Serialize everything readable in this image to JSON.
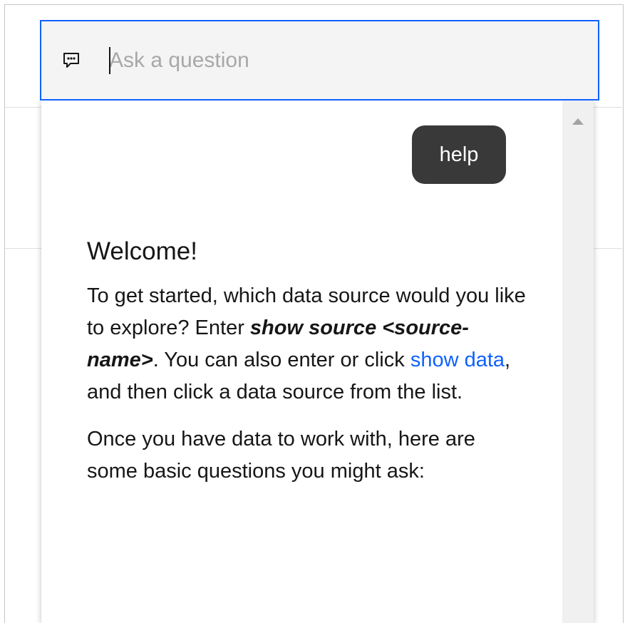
{
  "search": {
    "placeholder": "Ask a question",
    "value": ""
  },
  "conversation": {
    "user_message": "help",
    "response": {
      "title": "Welcome!",
      "p1_start": "To get started, which data source would you like to explore? Enter ",
      "p1_command": "show source <source-name>",
      "p1_mid": ". You can also enter or click ",
      "p1_link": "show data",
      "p1_end": ", and then click a data source from the list.",
      "p2": "Once you have data to work with, here are some basic questions you might ask:"
    }
  },
  "icons": {
    "search_icon": "chat-bubble-icon",
    "scroll_up": "scroll-up-arrow-icon"
  },
  "colors": {
    "accent": "#0f62fe",
    "bubble_bg": "#393939",
    "input_bg": "#f4f4f4",
    "link": "#0f62fe"
  }
}
